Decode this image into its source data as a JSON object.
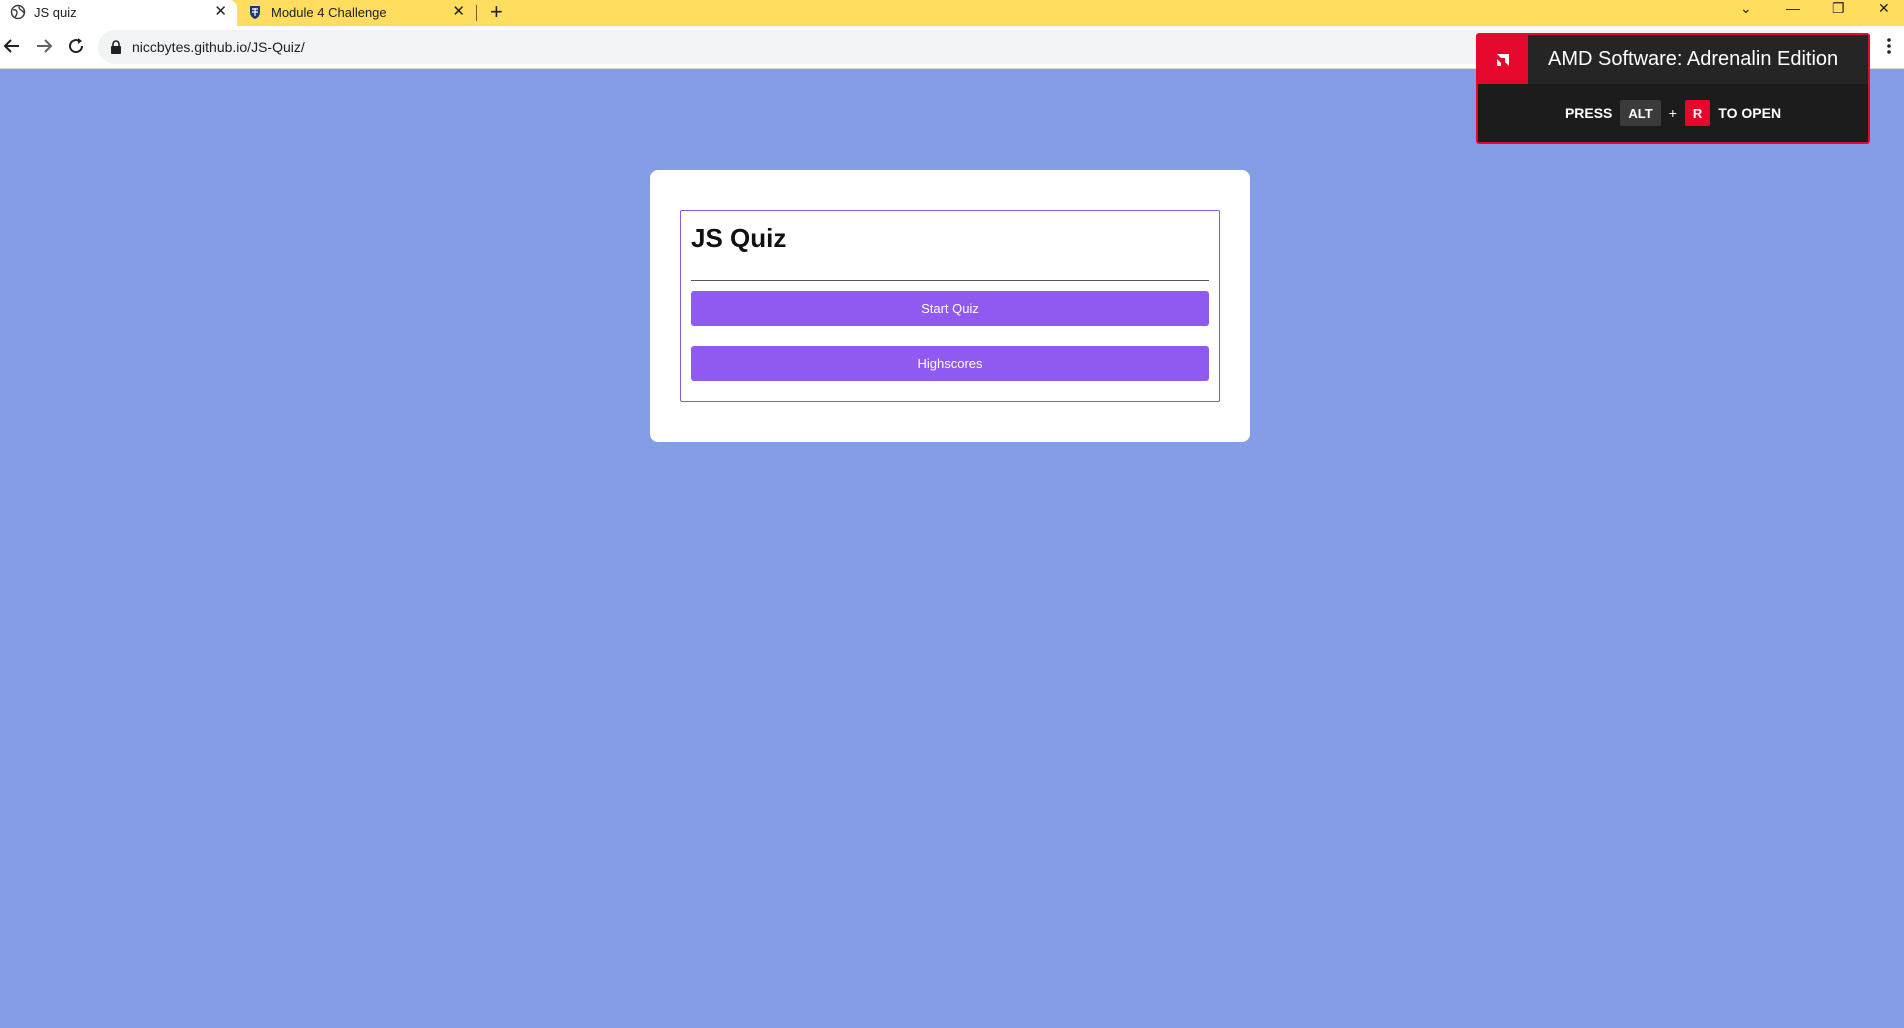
{
  "browser": {
    "tabs": [
      {
        "title": "JS quiz",
        "active": true,
        "favicon": "globe-icon"
      },
      {
        "title": "Module 4 Challenge",
        "active": false,
        "favicon": "shield-crest-icon"
      }
    ],
    "close_glyph": "✕",
    "new_tab_glyph": "+",
    "window_controls": {
      "dropdown": "⌄",
      "minimize": "—",
      "restore": "❐",
      "close": "✕"
    },
    "url": "niccbytes.github.io/JS-Quiz/",
    "tab_strip_color": "#fedd5f"
  },
  "page": {
    "background": "#859ce6",
    "quiz": {
      "title": "JS Quiz",
      "start_label": "Start Quiz",
      "highscores_label": "Highscores",
      "accent": "#9059ef"
    }
  },
  "overlay": {
    "title": "AMD Software: Adrenalin Edition",
    "press": "PRESS",
    "key1": "ALT",
    "plus": "+",
    "key2": "R",
    "to_open": "TO OPEN",
    "accent": "#e6082c"
  }
}
